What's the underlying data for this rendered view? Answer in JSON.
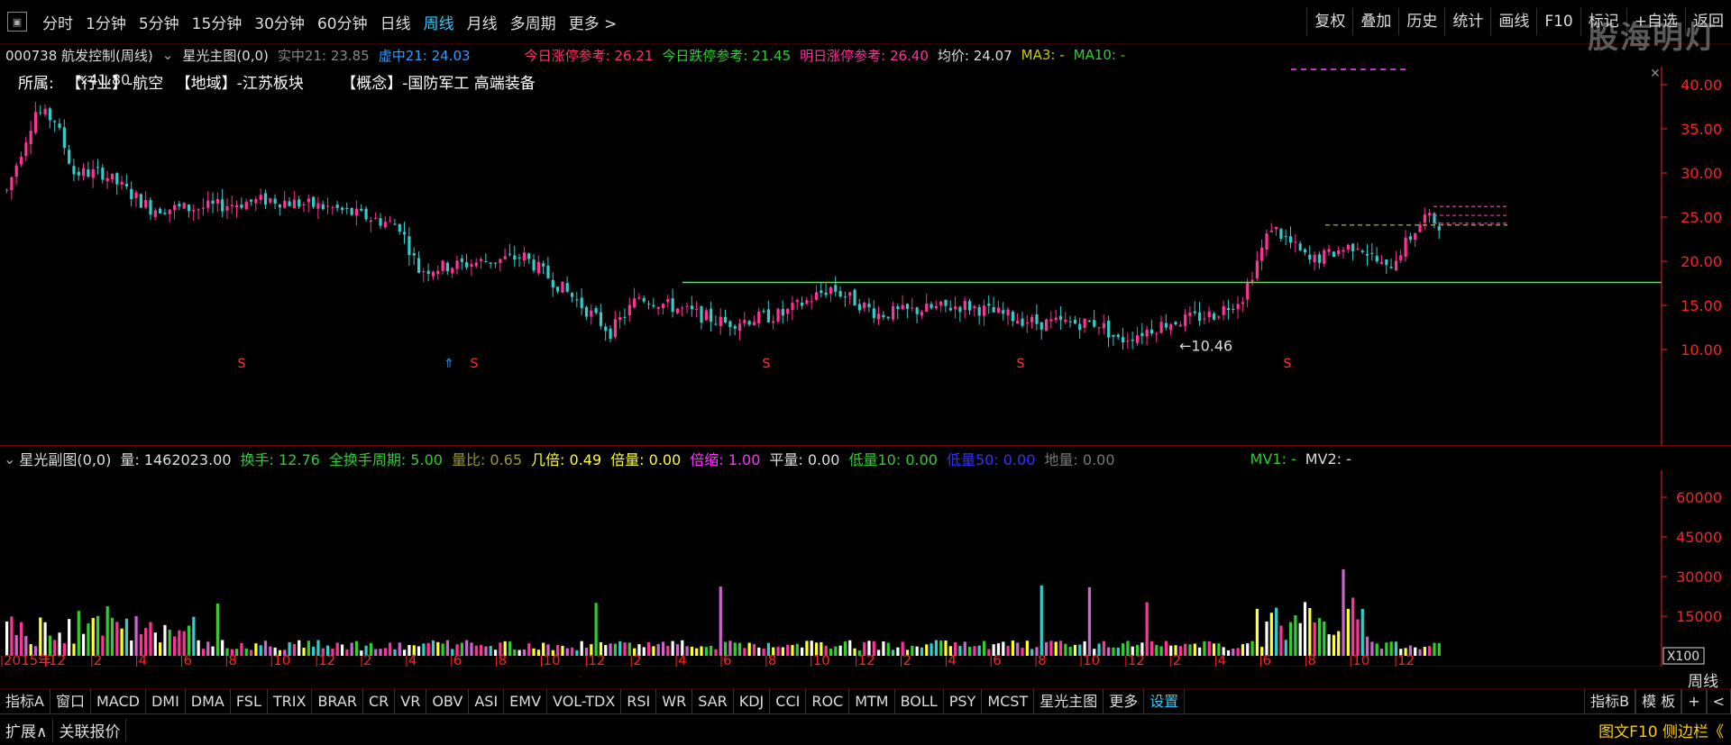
{
  "toolbar": {
    "periods": [
      "分时",
      "1分钟",
      "5分钟",
      "15分钟",
      "30分钟",
      "60分钟",
      "日线",
      "周线",
      "月线",
      "多周期",
      "更多 >"
    ],
    "active_period": "周线",
    "right_buttons": [
      "复权",
      "叠加",
      "历史",
      "统计",
      "画线",
      "F10",
      "标记",
      "+自选",
      "返回"
    ],
    "watermark": "股海明灯"
  },
  "info": {
    "code_name": "000738 航发控制(周线)",
    "indicator_name": "星光主图(0,0)",
    "real_mid": "实中21: 23.85",
    "virtual_mid": "虚中21: 24.03",
    "limit_up_today": "今日涨停参考: 26.21",
    "limit_down_today": "今日跌停参考: 21.45",
    "limit_up_tomorrow": "明日涨停参考: 26.40",
    "avg_price": "均价: 24.07",
    "ma3": "MA3: -",
    "ma10": "MA10: -"
  },
  "belong": {
    "label": "所属:",
    "industry": "【行业】-航空",
    "region": "【地域】-江苏板块",
    "concept": "【概念】-国防军工 高端装备"
  },
  "main_chart": {
    "y_ticks": [
      "40.00",
      "35.00",
      "30.00",
      "25.00",
      "20.00",
      "15.00",
      "10.00"
    ],
    "high_label": "41.80",
    "low_label": "10.46",
    "s_marker": "S",
    "colors": {
      "up": "#ff3399",
      "down": "#33cccc",
      "green_line": "#33ff33",
      "yellow_line": "#cccc00",
      "pink_line": "#ff3399",
      "axis": "#ff2222"
    }
  },
  "sub_info": {
    "indicator_name": "星光副图(0,0)",
    "volume": "量: 1462023.00",
    "turnover": "换手: 12.76",
    "full_cycle": "全换手周期: 5.00",
    "vol_ratio": "量比: 0.65",
    "times": "几倍: 0.49",
    "double": "倍量: 0.00",
    "shrink": "倍缩: 1.00",
    "flat": "平量: 0.00",
    "low10": "低量10: 0.00",
    "low50": "低量50: 0.00",
    "ground": "地量: 0.00",
    "mv1": "MV1: -",
    "mv2": "MV2: -"
  },
  "sub_chart": {
    "y_ticks": [
      "60000",
      "45000",
      "30000",
      "15000"
    ],
    "unit": "X100"
  },
  "x_axis": [
    "2015年",
    "12",
    "2",
    "4",
    "6",
    "8",
    "10",
    "12",
    "2",
    "4",
    "6",
    "8",
    "10",
    "12",
    "2",
    "4",
    "6",
    "8",
    "10",
    "12",
    "2",
    "4",
    "6",
    "8",
    "10",
    "12",
    "2",
    "4",
    "6",
    "8",
    "10",
    "12"
  ],
  "period_label": "周线",
  "indicator_tabs": [
    "指标A",
    "窗口",
    "MACD",
    "DMI",
    "DMA",
    "FSL",
    "TRIX",
    "BRAR",
    "CR",
    "VR",
    "OBV",
    "ASI",
    "EMV",
    "VOL-TDX",
    "RSI",
    "WR",
    "SAR",
    "KDJ",
    "CCI",
    "ROC",
    "MTM",
    "BOLL",
    "PSY",
    "MCST",
    "星光主图",
    "更多",
    "设置"
  ],
  "indicator_right": [
    "指标B",
    "模 板",
    "+",
    "<"
  ],
  "bottom": {
    "expand": "扩展∧",
    "related": "关联报价",
    "right": "图文F10 侧边栏《"
  }
}
